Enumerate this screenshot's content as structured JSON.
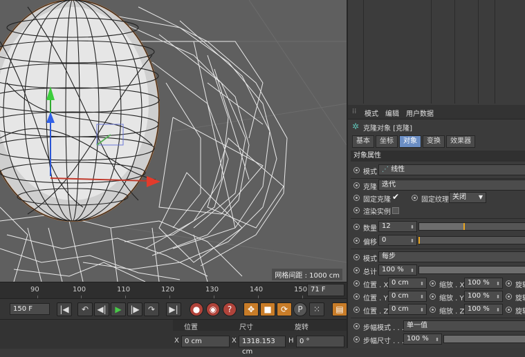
{
  "viewport": {
    "grid_readout": "网格间距 : 1000 cm"
  },
  "timeline": {
    "ruler": [
      "90",
      "100",
      "110",
      "120",
      "130",
      "140",
      "150"
    ],
    "current_frame": "71 F"
  },
  "transport": {
    "end_frame": "150 F"
  },
  "coords": {
    "col_position": "位置",
    "col_size": "尺寸",
    "col_rotation": "旋转",
    "x_label": "X",
    "x_position": "0 cm",
    "x_size": "1318.153 cm",
    "h_label": "H",
    "h_rotation": "0 °"
  },
  "attributes": {
    "menu": [
      "模式",
      "编辑",
      "用户数据"
    ],
    "object_title": "克隆对象 [克隆]",
    "tabs": [
      "基本",
      "坐标",
      "对象",
      "变换",
      "效果器"
    ],
    "active_tab": "对象",
    "section_title": "对象属性",
    "mode_label": "模式",
    "mode_value": "线性",
    "clone_label": "克隆",
    "clone_value": "迭代",
    "fix_clone_label": "固定克隆",
    "fix_texture_label": "固定纹理",
    "fix_texture_value": "关闭",
    "render_instances_label": "渲染实例",
    "count_label": "数量",
    "count_value": "12",
    "count_slider": 0.42,
    "offset_label": "偏移",
    "offset_value": "0",
    "offset_slider": 0.0,
    "mode2_label": "模式",
    "mode2_value": "每步",
    "total_label": "总计",
    "total_value": "100 %",
    "pos_x_label": "位置 . X",
    "pos_x_value": "0 cm",
    "scale_x_label": "缩放 . X",
    "scale_x_value": "100 %",
    "pos_y_label": "位置 . Y",
    "pos_y_value": "0 cm",
    "scale_y_label": "缩放 . Y",
    "scale_y_value": "100 %",
    "pos_z_label": "位置 . Z",
    "pos_z_value": "0 cm",
    "scale_z_label": "缩放 . Z",
    "scale_z_value": "100 %",
    "rot_label": "旋转",
    "step_mode_label": "步幅模式 . . .",
    "step_mode_value": "单一值",
    "step_size_label": "步幅尺寸 . . .",
    "step_size_value": "100 %"
  }
}
